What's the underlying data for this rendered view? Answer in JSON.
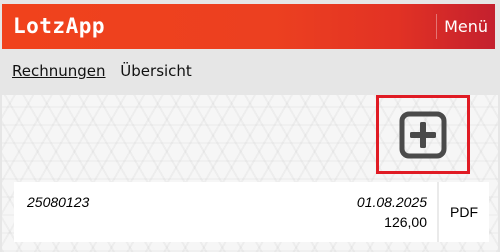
{
  "header": {
    "title": "LotzApp",
    "menu_label": "Menü"
  },
  "nav": {
    "items": [
      {
        "label": "Rechnungen",
        "active": true
      },
      {
        "label": "Übersicht",
        "active": false
      }
    ]
  },
  "actions": {
    "add_icon": "plus-square-icon"
  },
  "invoices": [
    {
      "number": "25080123",
      "date": "01.08.2025",
      "amount": "126,00",
      "pdf_label": "PDF"
    }
  ],
  "colors": {
    "header_start": "#f0421c",
    "header_end": "#c4202e",
    "highlight_border": "#e01b24",
    "icon": "#4a4a4a"
  }
}
